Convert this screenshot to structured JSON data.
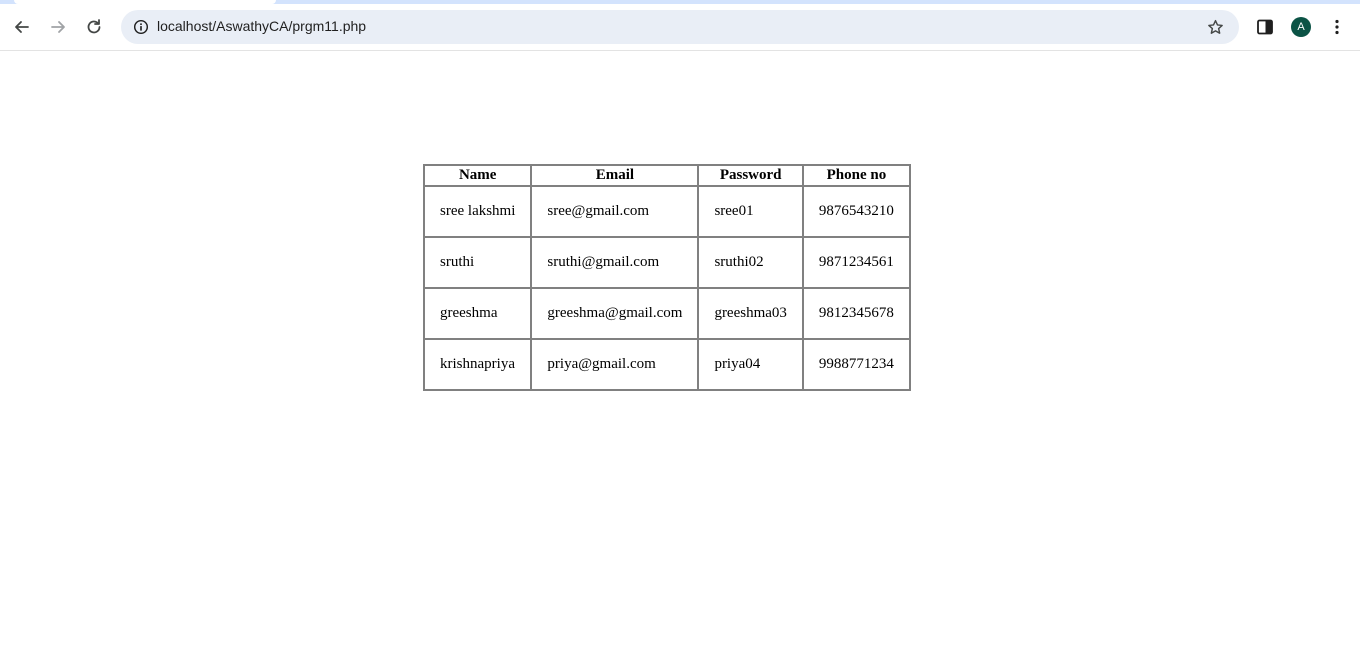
{
  "browser": {
    "url": "localhost/AswathyCA/prgm11.php",
    "profile_initial": "A",
    "profile_color": "#0b5345",
    "icons": {
      "back": "arrow-left-icon",
      "forward": "arrow-right-icon",
      "reload": "reload-icon",
      "site_info": "info-icon",
      "bookmark": "star-icon",
      "side_panel": "side-panel-icon",
      "menu": "kebab-menu-icon"
    }
  },
  "table": {
    "headers": {
      "name": "Name",
      "email": "Email",
      "password": "Password",
      "phone": "Phone no"
    },
    "rows": [
      {
        "name": "sree lakshmi",
        "email": "sree@gmail.com",
        "password": "sree01",
        "phone": "9876543210"
      },
      {
        "name": "sruthi",
        "email": "sruthi@gmail.com",
        "password": "sruthi02",
        "phone": "9871234561"
      },
      {
        "name": "greeshma",
        "email": "greeshma@gmail.com",
        "password": "greeshma03",
        "phone": "9812345678"
      },
      {
        "name": "krishnapriya",
        "email": "priya@gmail.com",
        "password": "priya04",
        "phone": "9988771234"
      }
    ]
  }
}
